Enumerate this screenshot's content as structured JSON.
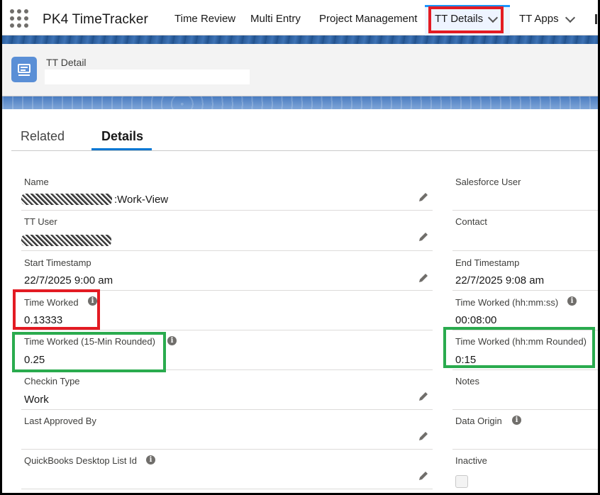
{
  "app": {
    "name": "PK4 TimeTracker"
  },
  "nav": {
    "items": [
      "Time Review",
      "Multi Entry",
      "Project Management",
      "TT Details",
      "TT Apps"
    ],
    "active": "TT Details"
  },
  "header": {
    "object_type": "TT Detail"
  },
  "tabs": {
    "related": "Related",
    "details": "Details"
  },
  "left_fields": [
    {
      "label": "Name",
      "value": ":Work-View"
    },
    {
      "label": "TT User",
      "value": ""
    },
    {
      "label": "Start Timestamp",
      "value": "22/7/2025 9:00 am"
    },
    {
      "label": "Time Worked",
      "value": "0.13333"
    },
    {
      "label": "Time Worked (15-Min Rounded)",
      "value": "0.25"
    },
    {
      "label": "Checkin Type",
      "value": "Work"
    },
    {
      "label": "Last Approved By",
      "value": ""
    },
    {
      "label": "QuickBooks Desktop List Id",
      "value": ""
    }
  ],
  "right_fields": [
    {
      "label": "Salesforce User",
      "value": ""
    },
    {
      "label": "Contact",
      "value": ""
    },
    {
      "label": "End Timestamp",
      "value": "22/7/2025 9:08 am"
    },
    {
      "label": "Time Worked (hh:mm:ss)",
      "value": "00:08:00"
    },
    {
      "label": "Time Worked (hh:mm Rounded)",
      "value": "0:15"
    },
    {
      "label": "Notes",
      "value": ""
    },
    {
      "label": "Data Origin",
      "value": ""
    },
    {
      "label": "Inactive",
      "value": ""
    }
  ],
  "icons": {
    "info": "i",
    "app_launcher": "waffle-icon",
    "edit": "pencil-icon"
  },
  "colors": {
    "highlight_red": "#e31b23",
    "highlight_green": "#2aab4e",
    "accent": "#0176d3"
  }
}
